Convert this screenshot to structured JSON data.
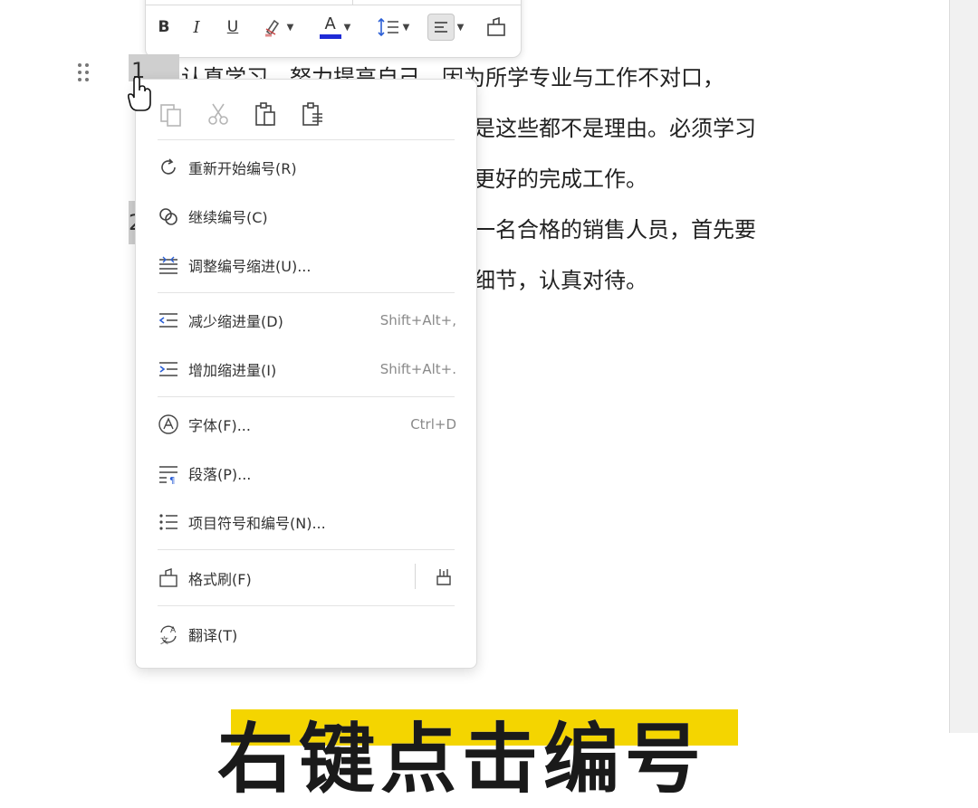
{
  "toolbar": {
    "bold_label": "B",
    "italic_label": "I",
    "underline_label": "U",
    "font_color_label": "A",
    "font_color_bar": "#1f2bd6",
    "highlight_icon": "highlighter-icon",
    "spacing_icon": "line-spacing-icon",
    "align_icon": "align-left-icon",
    "painter_icon": "format-painter-icon"
  },
  "document": {
    "list_number_1": "1",
    "list_number_2": "2",
    "lines": [
      "认真学习，努力提高自己。因为所学专业与工作不对口，",
      "是这些都不是理由。必须学习",
      "更好的完成工作。",
      "一名合格的销售人员，首先要",
      "细节，认真对待。"
    ]
  },
  "context_menu": {
    "clipboard_icons": [
      "copy-icon",
      "cut-icon",
      "paste-icon",
      "paste-special-icon"
    ],
    "items": [
      {
        "label": "重新开始编号(R)",
        "shortcut": "",
        "icon": "restart-numbering-icon"
      },
      {
        "label": "继续编号(C)",
        "shortcut": "",
        "icon": "continue-numbering-icon"
      },
      {
        "label": "调整编号缩进(U)...",
        "shortcut": "",
        "icon": "adjust-indent-icon"
      },
      {
        "label": "减少缩进量(D)",
        "shortcut": "Shift+Alt+,",
        "icon": "decrease-indent-icon"
      },
      {
        "label": "增加缩进量(I)",
        "shortcut": "Shift+Alt+.",
        "icon": "increase-indent-icon"
      },
      {
        "label": "字体(F)...",
        "shortcut": "Ctrl+D",
        "icon": "font-icon"
      },
      {
        "label": "段落(P)...",
        "shortcut": "",
        "icon": "paragraph-icon"
      },
      {
        "label": "项目符号和编号(N)...",
        "shortcut": "",
        "icon": "bullets-numbering-icon"
      },
      {
        "label": "格式刷(F)",
        "shortcut": "",
        "icon": "format-painter-icon"
      },
      {
        "label": "翻译(T)",
        "shortcut": "",
        "icon": "translate-icon"
      }
    ]
  },
  "caption": {
    "text": "右键点击编号"
  }
}
